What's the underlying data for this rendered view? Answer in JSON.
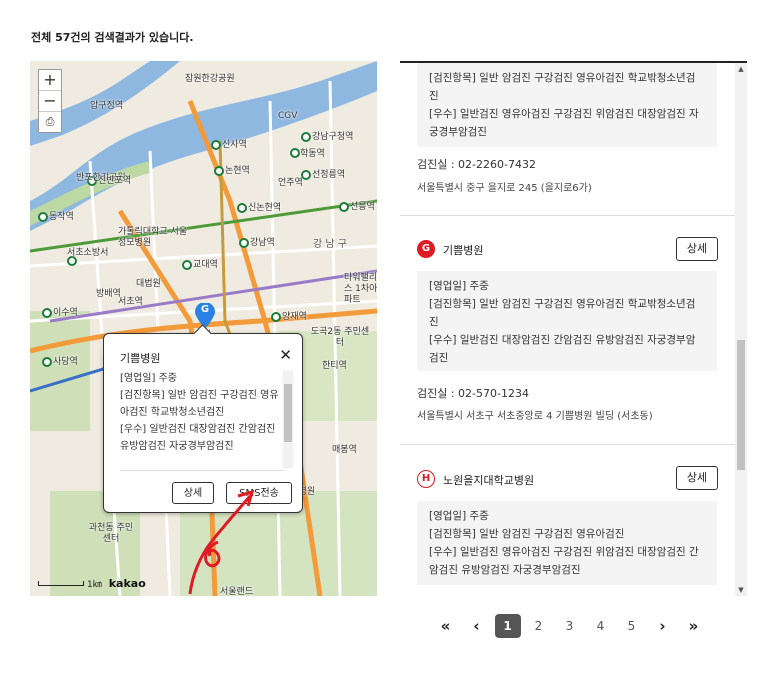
{
  "summary": "전체 57건의 검색결과가 있습니다.",
  "map": {
    "zoom_in": "+",
    "zoom_out": "−",
    "scale_label": "1㎞",
    "brand": "kakao",
    "marker_letter": "G",
    "labels": [
      "잠원한강공원",
      "반포한강공원",
      "CGV",
      "신사역",
      "강남구청역",
      "논현역",
      "선정릉역",
      "신논현역",
      "선릉역",
      "동작역",
      "가톨릭대학교 서울성모병원",
      "서초소방서",
      "강남역",
      "강 남 구",
      "교대역",
      "대법원",
      "타워팰리스 1차아파트",
      "양재역",
      "도곡2동 주민센터",
      "이수역",
      "사당역",
      "과천동 주민센터",
      "서울랜드",
      "신반포역",
      "학동역",
      "언주역",
      "서초역",
      "방배역",
      "압구정역",
      "한티역",
      "매봉역",
      "을지병원"
    ],
    "popup": {
      "title": "기쁨병원",
      "close": "✕",
      "lines": [
        "[영업일] 주중",
        "[검진항목] 일반 암검진 구강검진 영유아검진 학교밖청소년검진",
        "[우수] 일반검진 대장암검진 간암검진 유방암검진 자궁경부암검진"
      ],
      "detail_btn": "상세",
      "sms_btn": "SMS전송"
    }
  },
  "list": {
    "items": [
      {
        "info": [
          "[검진항목] 일반 암검진 구강검진 영유아검진 학교밖청소년검진",
          "[우수] 일반검진 영유아검진 구강검진 위암검진 대장암검진 자궁경부암검진"
        ],
        "tel": "검진실 :  02-2260-7432",
        "addr": "서울특별시 중구 을지로 245 (을지로6가)"
      },
      {
        "badge": "G",
        "name": "기쁨병원",
        "detail_btn": "상세",
        "info": [
          "[영업일] 주중",
          "[검진항목] 일반 암검진 구강검진 영유아검진 학교밖청소년검진",
          "[우수] 일반검진 대장암검진 간암검진 유방암검진 자궁경부암검진"
        ],
        "tel": "검진실 :  02-570-1234",
        "addr": "서울특별시 서초구 서초중앙로 4 기쁨병원 빌딩 (서초동)"
      },
      {
        "badge": "H",
        "name": "노원을지대학교병원",
        "detail_btn": "상세",
        "info": [
          "[영업일] 주중",
          "[검진항목] 일반 암검진 구강검진 영유아검진",
          "[우수] 일반검진 영유아검진 구강검진 위암검진 대장암검진 간암검진 유방암검진 자궁경부암검진"
        ]
      }
    ]
  },
  "pagination": {
    "first": "«",
    "prev": "‹",
    "pages": [
      "1",
      "2",
      "3",
      "4",
      "5"
    ],
    "current": "1",
    "next": "›",
    "last": "»"
  },
  "colors": {
    "accent": "#e01b24",
    "river": "#8fb8e0",
    "road_orange": "#f39a3a"
  }
}
